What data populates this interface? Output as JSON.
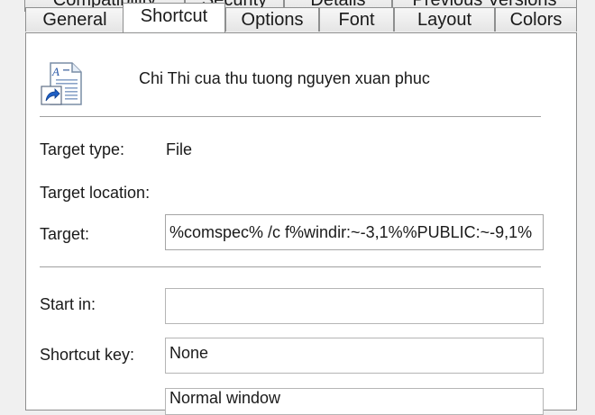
{
  "dialog": {
    "tabs_back": [
      "Compatibility",
      "Security",
      "Details",
      "Previous Versions"
    ],
    "tabs_front": [
      "General",
      "Shortcut",
      "Options",
      "Font",
      "Layout",
      "Colors"
    ],
    "active_tab": "Shortcut"
  },
  "shortcut": {
    "name": "Chi Thi cua thu tuong nguyen xuan phuc",
    "icon": "document-shortcut-icon",
    "target_type_label": "Target type:",
    "target_type_value": "File",
    "target_location_label": "Target location:",
    "target_label": "Target:",
    "target_value": "%comspec% /c f%windir:~-3,1%%PUBLIC:~-9,1%",
    "start_in_label": "Start in:",
    "start_in_value": "",
    "shortcut_key_label": "Shortcut key:",
    "shortcut_key_value": "None",
    "run_value": "Normal window"
  }
}
